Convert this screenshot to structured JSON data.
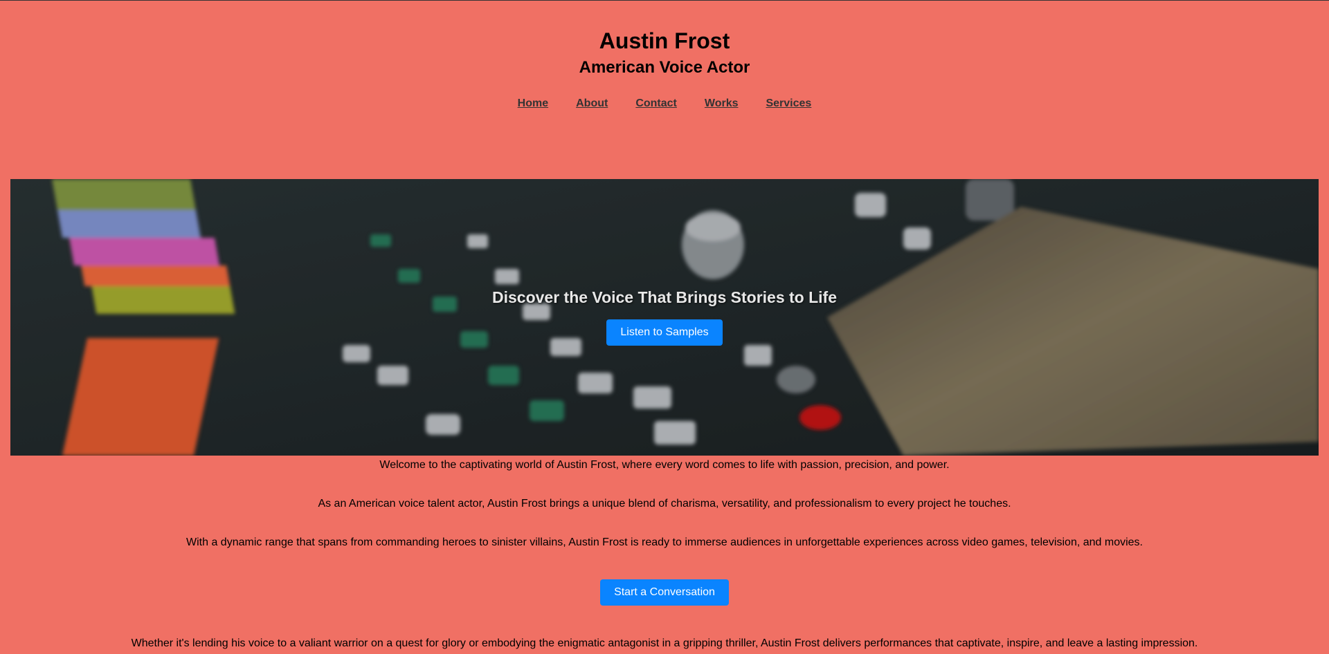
{
  "header": {
    "title": "Austin Frost",
    "subtitle": "American Voice Actor"
  },
  "nav": {
    "items": [
      {
        "label": "Home"
      },
      {
        "label": "About"
      },
      {
        "label": "Contact"
      },
      {
        "label": "Works"
      },
      {
        "label": "Services"
      }
    ]
  },
  "hero": {
    "heading": "Discover the Voice That Brings Stories to Life",
    "button_label": "Listen to Samples",
    "image": "audio-mixing-console"
  },
  "content": {
    "paragraphs": [
      "Welcome to the captivating world of Austin Frost, where every word comes to life with passion, precision, and power.",
      "As an American voice talent actor, Austin Frost brings a unique blend of charisma, versatility, and professionalism to every project he touches.",
      "With a dynamic range that spans from commanding heroes to sinister villains, Austin Frost is ready to immerse audiences in unforgettable experiences across video games, television, and movies.",
      "Whether it's lending his voice to a valiant warrior on a quest for glory or embodying the enigmatic antagonist in a gripping thriller, Austin Frost delivers performances that captivate, inspire, and leave a lasting impression."
    ],
    "cta_label": "Start a Conversation"
  },
  "colors": {
    "background": "#f07064",
    "button": "#0a84ff"
  }
}
